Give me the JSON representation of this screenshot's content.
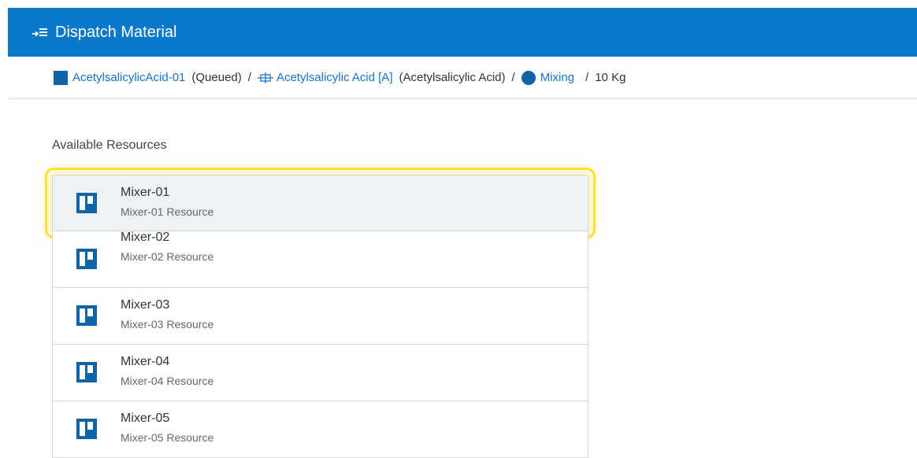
{
  "header": {
    "title": "Dispatch Material",
    "icon": "dispatch-list-icon",
    "background": "#0a78c8"
  },
  "breadcrumb": {
    "order_link": "AcetylsalicylicAcid-01",
    "order_status": "(Queued)",
    "material_link": "Acetylsalicylic Acid [A]",
    "material_name": "(Acetylsalicylic Acid)",
    "step_link": "Mixing",
    "quantity": "10 Kg",
    "separator": "/"
  },
  "resources": {
    "label": "Available Resources",
    "items": [
      {
        "name": "Mixer-01",
        "description": "Mixer-01 Resource",
        "selected": true
      },
      {
        "name": "Mixer-02",
        "description": "Mixer-02 Resource"
      },
      {
        "name": "Mixer-03",
        "description": "Mixer-03 Resource"
      },
      {
        "name": "Mixer-04",
        "description": "Mixer-04 Resource"
      },
      {
        "name": "Mixer-05",
        "description": "Mixer-05 Resource"
      }
    ]
  },
  "colors": {
    "accent": "#0a78c8",
    "link": "#1a73c9",
    "icon": "#0f64a8",
    "highlight": "#ffe033"
  }
}
